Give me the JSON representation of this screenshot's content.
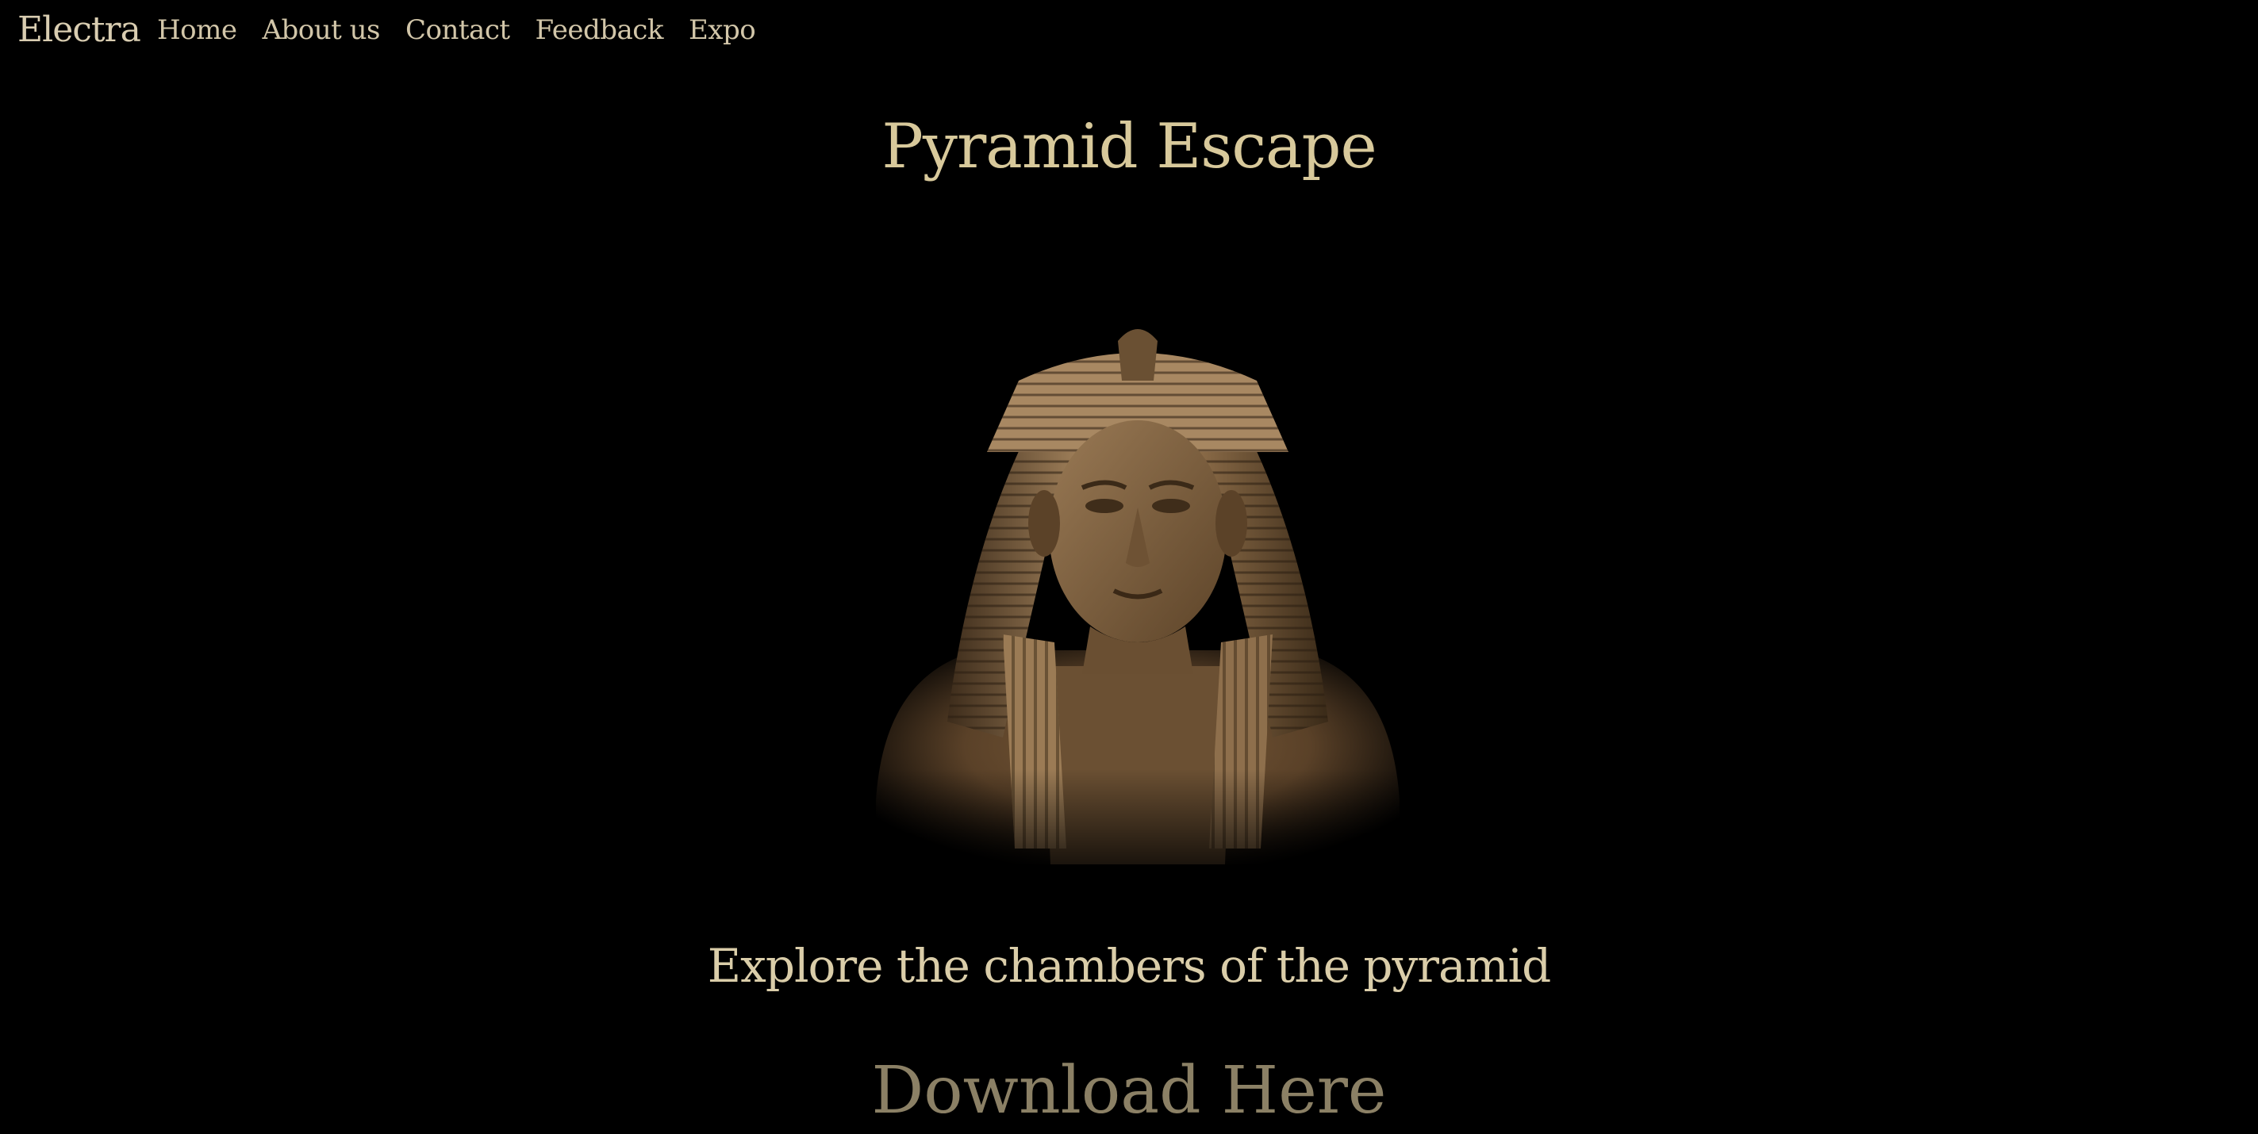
{
  "nav": {
    "brand": "Electra",
    "links": [
      "Home",
      "About us",
      "Contact",
      "Feedback",
      "Expo"
    ]
  },
  "main": {
    "title": "Pyramid Escape",
    "tagline": "Explore the chambers of the pyramid",
    "download_label": "Download Here",
    "hero_image": "pharaoh-bust-statue"
  },
  "colors": {
    "background": "#000000",
    "title": "#d8c99b",
    "text": "#d7cbb0",
    "download": "#8b8065",
    "statue": "#8a6a45"
  }
}
